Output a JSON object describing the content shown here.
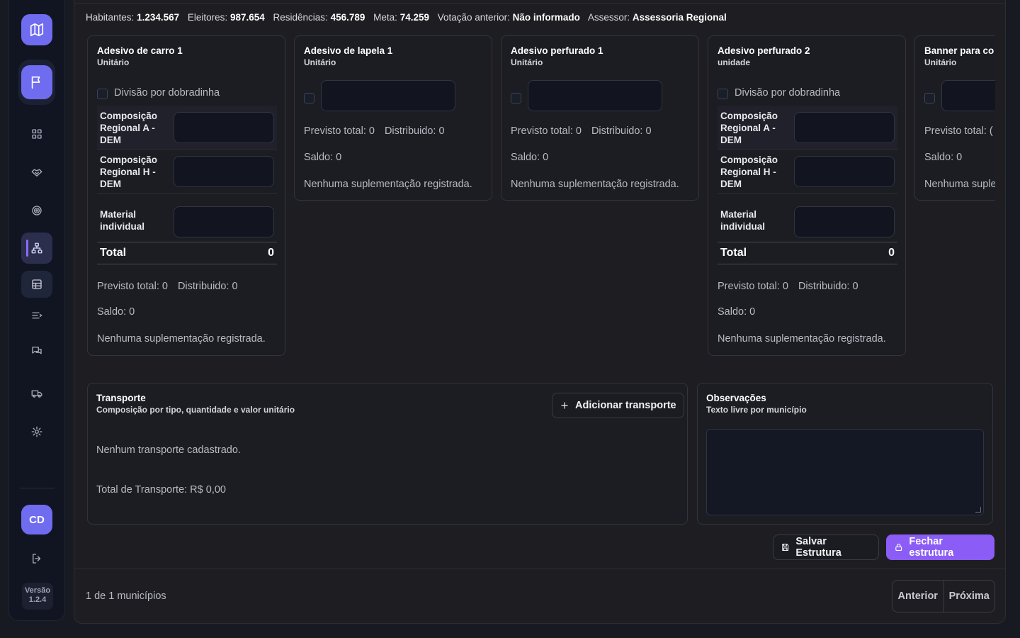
{
  "stats": [
    {
      "label": "Habitantes:",
      "value": "1.234.567"
    },
    {
      "label": "Eleitores:",
      "value": "987.654"
    },
    {
      "label": "Residências:",
      "value": "456.789"
    },
    {
      "label": "Meta:",
      "value": "74.259"
    },
    {
      "label": "Votação anterior:",
      "value": "Não informado"
    },
    {
      "label": "Assessor:",
      "value": "Assessoria Regional"
    }
  ],
  "common": {
    "split_label": "Divisão por dobradinha",
    "comp_a": "Composição Regional A - DEM",
    "comp_h": "Composição Regional H - DEM",
    "individual": "Material individual",
    "total_label": "Total",
    "total_value": "0",
    "forecast": "Previsto total: 0",
    "distributed": "Distribuido: 0",
    "balance": "Saldo: 0",
    "no_supplement": "Nenhuma suplementação registrada."
  },
  "cards": [
    {
      "title": "Adesivo de carro 1",
      "unit": "Unitário"
    },
    {
      "title": "Adesivo de lapela 1",
      "unit": "Unitário"
    },
    {
      "title": "Adesivo perfurado 1",
      "unit": "Unitário"
    },
    {
      "title": "Adesivo perfurado 2",
      "unit": "unidade"
    },
    {
      "title": "Banner para co",
      "unit": "Unitário",
      "forecast_cut": "Previsto total: (",
      "balance": "Saldo: 0",
      "no_supplement_cut": "Nenhuma suple"
    }
  ],
  "transport": {
    "title": "Transporte",
    "subtitle": "Composição por tipo, quantidade e valor unitário",
    "add_label": "Adicionar transporte",
    "empty": "Nenhum transporte cadastrado.",
    "total": "Total de Transporte: R$ 0,00"
  },
  "notes": {
    "title": "Observações",
    "subtitle": "Texto livre por município"
  },
  "actions": {
    "save": "Salvar Estrutura",
    "close": "Fechar estrutura"
  },
  "pager": {
    "text": "1 de 1 municípios",
    "prev": "Anterior",
    "next": "Próxima"
  },
  "user": {
    "initials": "CD"
  },
  "version": {
    "label": "Versão",
    "number": "1.2.4"
  }
}
